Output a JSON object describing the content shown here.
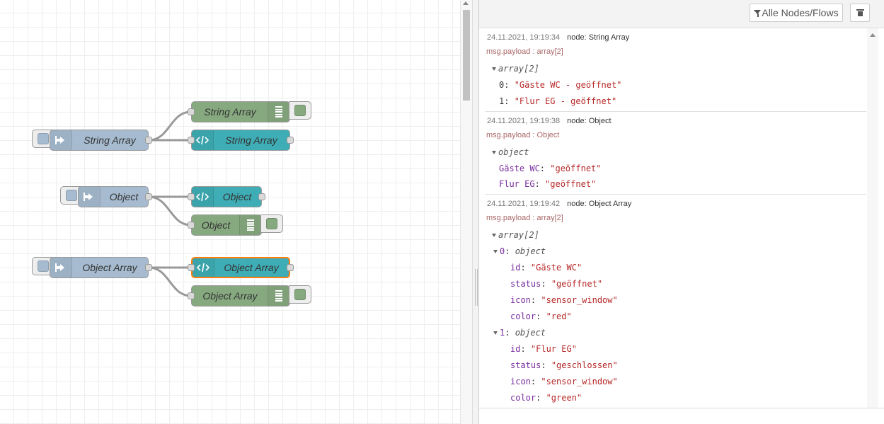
{
  "flow": {
    "nodes": [
      {
        "id": "inject-string-array",
        "type": "inject",
        "label": "String Array"
      },
      {
        "id": "debug-string-array",
        "type": "debug",
        "label": "String Array"
      },
      {
        "id": "template-string-array",
        "type": "template",
        "label": "String Array"
      },
      {
        "id": "inject-object",
        "type": "inject",
        "label": "Object"
      },
      {
        "id": "template-object",
        "type": "template",
        "label": "Object"
      },
      {
        "id": "debug-object",
        "type": "debug",
        "label": "Object"
      },
      {
        "id": "inject-object-array",
        "type": "inject",
        "label": "Object Array"
      },
      {
        "id": "template-object-array",
        "type": "template",
        "label": "Object Array",
        "selected": true
      },
      {
        "id": "debug-object-array",
        "type": "debug",
        "label": "Object Array"
      }
    ]
  },
  "sidebar": {
    "filter_label": "Alle Nodes/Flows",
    "filter_icon": "funnel-icon",
    "clear_icon": "trash-icon",
    "messages": [
      {
        "timestamp": "24.11.2021, 19:19:34",
        "node": "node: String Array",
        "topic": "msg.payload : array[2]",
        "tree": [
          {
            "caret": true,
            "type": "array[2]"
          },
          {
            "key": "0",
            "value": "\"Gäste WC - geöffnet\""
          },
          {
            "key": "1",
            "value": "\"Flur EG - geöffnet\""
          }
        ]
      },
      {
        "timestamp": "24.11.2021, 19:19:38",
        "node": "node: Object",
        "topic": "msg.payload : Object",
        "tree": [
          {
            "caret": true,
            "type": "object"
          },
          {
            "key": "Gäste WC",
            "value": "\"geöffnet\""
          },
          {
            "key": "Flur EG",
            "value": "\"geöffnet\""
          }
        ]
      },
      {
        "timestamp": "24.11.2021, 19:19:42",
        "node": "node: Object Array",
        "topic": "msg.payload : array[2]",
        "tree": [
          {
            "caret": true,
            "type": "array[2]"
          },
          {
            "caret": true,
            "key": "0",
            "type": "object"
          },
          {
            "key": "id",
            "value": "\"Gäste WC\""
          },
          {
            "key": "status",
            "value": "\"geöffnet\""
          },
          {
            "key": "icon",
            "value": "\"sensor_window\""
          },
          {
            "key": "color",
            "value": "\"red\""
          },
          {
            "caret": true,
            "key": "1",
            "type": "object"
          },
          {
            "key": "id",
            "value": "\"Flur EG\""
          },
          {
            "key": "status",
            "value": "\"geschlossen\""
          },
          {
            "key": "icon",
            "value": "\"sensor_window\""
          },
          {
            "key": "color",
            "value": "\"green\""
          }
        ]
      }
    ]
  },
  "colors": {
    "inject": "#a6bbcf",
    "debug": "#87a980",
    "template": "#3fadb5",
    "selected_border": "#ff7f0e",
    "key": "#792e9e",
    "string": "#b72828"
  }
}
